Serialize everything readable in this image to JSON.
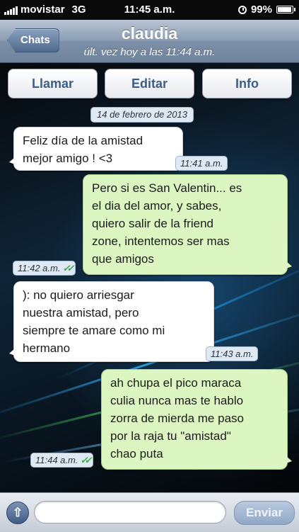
{
  "status_bar": {
    "carrier": "movistar",
    "network": "3G",
    "time": "11:45 a.m.",
    "battery": "99%",
    "battery_level": 0.99,
    "icons": [
      "signal-icon",
      "clock-icon",
      "battery-icon"
    ]
  },
  "nav": {
    "back_label": "Chats",
    "title": "claudia",
    "subtitle": "últ. vez hoy a las 11:44 a.m."
  },
  "actions": {
    "call": "Llamar",
    "edit": "Editar",
    "info": "Info"
  },
  "date_separator": "14 de febrero de 2013",
  "messages": [
    {
      "direction": "incoming",
      "lines": [
        "Feliz día de la amistad",
        "mejor amigo ! <3"
      ],
      "time": "11:41 a.m.",
      "read": false
    },
    {
      "direction": "outgoing",
      "lines": [
        "Pero si es San Valentin... es",
        "el dia del amor, y sabes,",
        "quiero salir de la friend",
        "zone, intentemos ser mas",
        "que amigos"
      ],
      "time": "11:42 a.m.",
      "read": true
    },
    {
      "direction": "incoming",
      "lines": [
        "): no quiero arriesgar",
        "nuestra amistad, pero",
        "siempre te amare como mi",
        "hermano"
      ],
      "time": "11:43 a.m.",
      "read": false
    },
    {
      "direction": "outgoing",
      "lines": [
        "ah chupa el pico maraca",
        "culia nunca mas te hablo",
        "zorra de mierda me paso",
        "por la raja tu \"amistad\"",
        "chao puta"
      ],
      "time": "11:44 a.m.",
      "read": true
    }
  ],
  "composer": {
    "attach_icon": "upload-arrow-icon",
    "attach_glyph": "⇧",
    "input_value": "",
    "input_placeholder": "",
    "send_label": "Enviar"
  },
  "check_glyph": "✓✓",
  "colors": {
    "incoming_bubble": "#ffffff",
    "outgoing_bubble": "#dcf6c2",
    "nav_bar": "#8b9db3",
    "action_text": "#3c5d87",
    "read_check": "#3aa845"
  }
}
